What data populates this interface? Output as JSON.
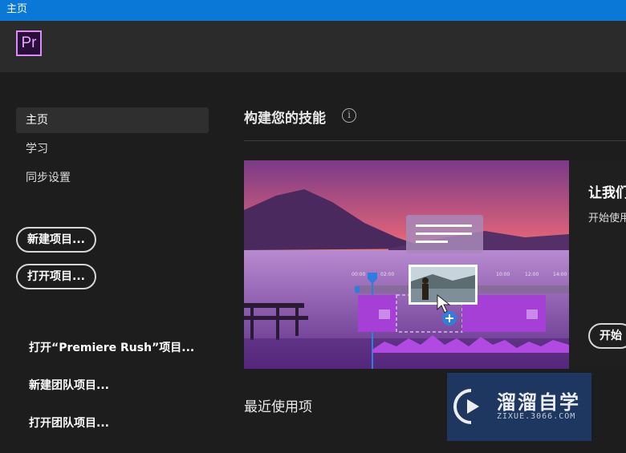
{
  "window": {
    "title": "主页"
  },
  "app": {
    "logo_text": "Pr"
  },
  "sidebar": {
    "nav": [
      {
        "label": "主页",
        "active": true
      },
      {
        "label": "学习",
        "active": false
      },
      {
        "label": "同步设置",
        "active": false
      }
    ],
    "buttons": {
      "new_project": "新建项目...",
      "open_project": "打开项目..."
    },
    "links": {
      "open_rush": "打开“Premiere Rush”项目...",
      "new_team": "新建团队项目...",
      "open_team": "打开团队项目..."
    }
  },
  "main": {
    "skills_title": "构建您的技能",
    "hero": {
      "timecodes": [
        "00:00",
        "02:00",
        "10:00",
        "12:00",
        "14:00"
      ]
    },
    "card": {
      "title": "让我们",
      "subtitle": "开始使用",
      "button": "开始"
    },
    "recent_title": "最近使用项"
  },
  "watermark": {
    "title": "溜溜自学",
    "url": "ZIXUE.3066.COM"
  },
  "colors": {
    "titlebar": "#0a78d6",
    "accent_purple": "#a63fd6",
    "timeline_blue": "#2f7de1"
  }
}
